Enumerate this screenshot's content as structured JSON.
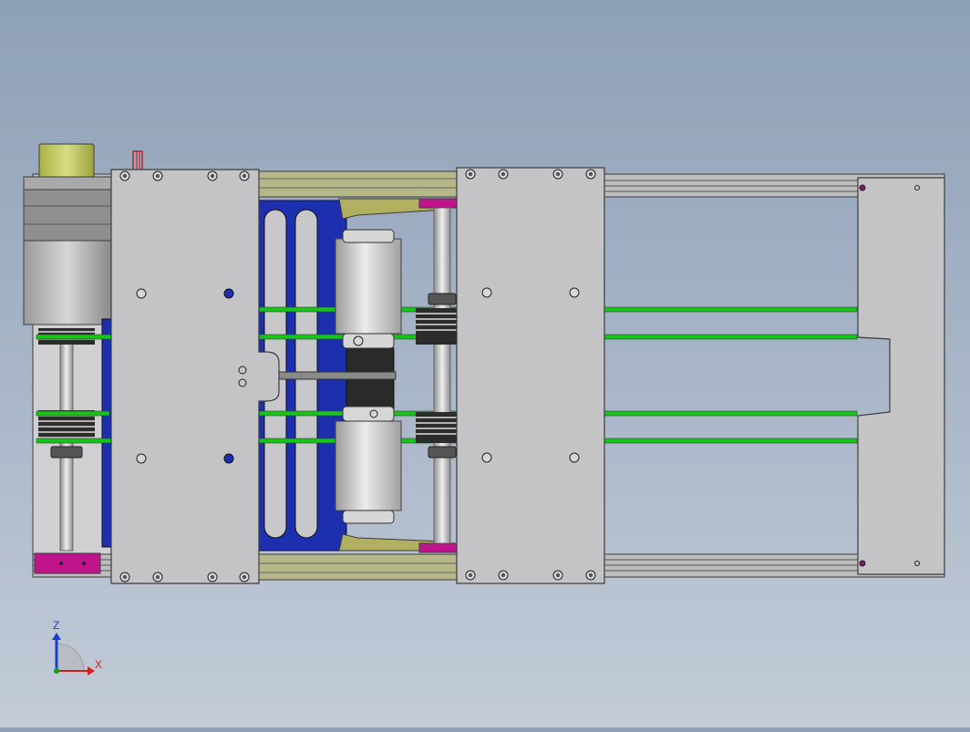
{
  "view": {
    "background_top": "#8ea0b7",
    "background_bottom": "#c3cbd7"
  },
  "colors": {
    "plate": "#c4c4c6",
    "plate_edge": "#4a4a4a",
    "rail": "#b9b9bb",
    "rail_olive": "#b9b98a",
    "rod_green": "#19c419",
    "frame_blue": "#1c2fae",
    "clamp_magenta": "#c0148c",
    "motor_yellow": "#c8d06a",
    "roller": "#d4d4d4",
    "roller_dark": "#2a2a2a",
    "shaft": "#c8c8c8"
  },
  "triad": {
    "z_label": "Z",
    "x_label": "X",
    "z_color": "#1a3fd0",
    "x_color": "#d02020",
    "y_color": "#10a010"
  },
  "components": {
    "stepper_motor": "stepper-motor",
    "left_carriage_plate": "carriage-plate",
    "middle_carriage_plate": "carriage-plate",
    "right_end_plate": "end-plate",
    "guide_rods": 4,
    "rollers": 2,
    "pulleys": 4
  }
}
